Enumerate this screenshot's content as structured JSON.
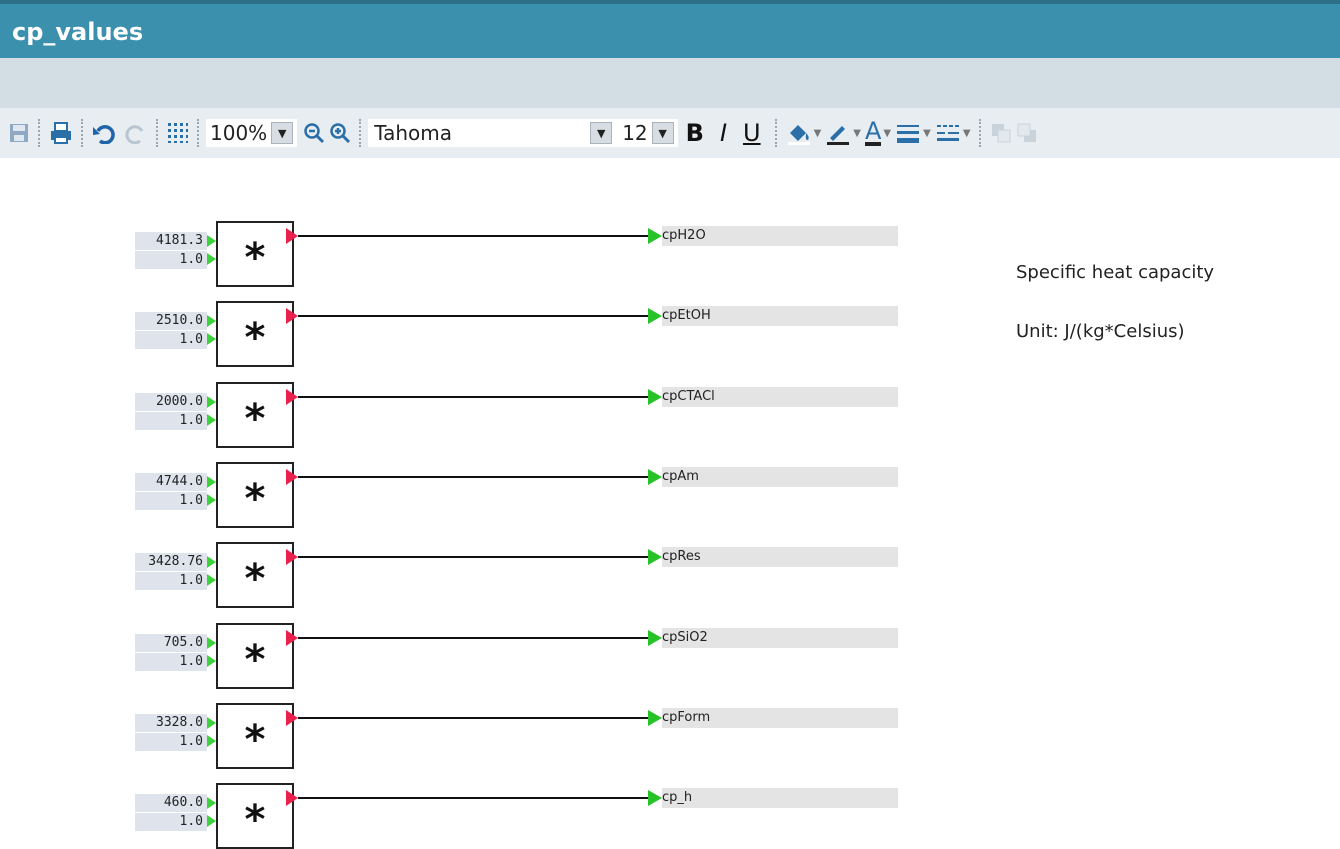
{
  "window": {
    "title": "cp_values"
  },
  "toolbar": {
    "zoom": "100%",
    "font": "Tahoma",
    "font_size": "12",
    "bold": "B",
    "italic": "I",
    "underline": "U",
    "text_color": "A"
  },
  "blocks": [
    {
      "in1": "4181.3",
      "in2": "1.0",
      "op": "*",
      "out": "cpH2O"
    },
    {
      "in1": "2510.0",
      "in2": "1.0",
      "op": "*",
      "out": "cpEtOH"
    },
    {
      "in1": "2000.0",
      "in2": "1.0",
      "op": "*",
      "out": "cpCTACl"
    },
    {
      "in1": "4744.0",
      "in2": "1.0",
      "op": "*",
      "out": "cpAm"
    },
    {
      "in1": "3428.76",
      "in2": "1.0",
      "op": "*",
      "out": "cpRes"
    },
    {
      "in1": "705.0",
      "in2": "1.0",
      "op": "*",
      "out": "cpSiO2"
    },
    {
      "in1": "3328.0",
      "in2": "1.0",
      "op": "*",
      "out": "cpForm"
    },
    {
      "in1": "460.0",
      "in2": "1.0",
      "op": "*",
      "out": "cp_h"
    }
  ],
  "notes": {
    "line1": "Specific heat capacity",
    "line2": "Unit: J/(kg*Celsius)"
  },
  "colors": {
    "titlebar": "#3b90ad",
    "input_port": "#3cd23c",
    "output_port": "#e8224c",
    "wire_arrow": "#27c227"
  }
}
